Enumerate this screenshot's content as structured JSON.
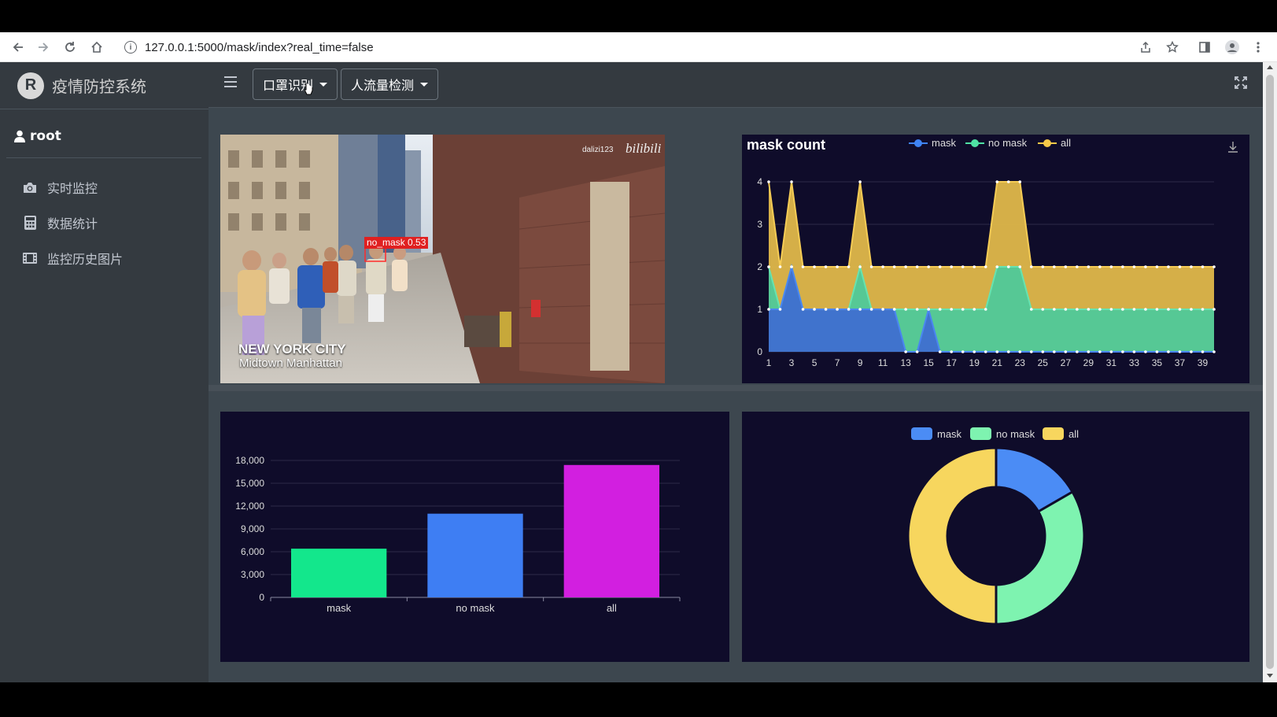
{
  "browser": {
    "url": "127.0.0.1:5000/mask/index?real_time=false",
    "info_glyph": "i"
  },
  "app": {
    "brand_letter": "R",
    "brand_title": "疫情防控系统",
    "user": "root",
    "menu": [
      {
        "label": "实时监控",
        "icon": "camera-icon"
      },
      {
        "label": "数据统计",
        "icon": "calculator-icon"
      },
      {
        "label": "监控历史图片",
        "icon": "film-icon"
      }
    ],
    "header": {
      "dropdowns": [
        "口罩识别",
        "人流量检测"
      ]
    }
  },
  "video": {
    "detection_label": "no_mask 0.53",
    "watermark": "dalizi123",
    "watermark_brand": "bilibili",
    "city_title": "NEW YORK CITY",
    "city_subtitle": "Midtown Manhattan"
  },
  "chart_data": [
    {
      "type": "area",
      "title": "mask count",
      "legend_position": "top",
      "legend": [
        "mask",
        "no mask",
        "all"
      ],
      "colors": {
        "mask": "#5470c6",
        "no mask": "#91cc75",
        "all": "#fac858"
      },
      "colors_display": {
        "mask": "#3f6fd0",
        "no mask": "#4fc99a",
        "all": "#e0b84a"
      },
      "x": [
        1,
        2,
        3,
        4,
        5,
        6,
        7,
        8,
        9,
        10,
        11,
        12,
        13,
        14,
        15,
        16,
        17,
        18,
        19,
        20,
        21,
        22,
        23,
        24,
        25,
        26,
        27,
        28,
        29,
        30,
        31,
        32,
        33,
        34,
        35,
        36,
        37,
        38,
        39,
        40
      ],
      "x_tick_labels": [
        "1",
        "3",
        "5",
        "7",
        "9",
        "11",
        "13",
        "15",
        "17",
        "19",
        "21",
        "23",
        "25",
        "27",
        "29",
        "31",
        "33",
        "35",
        "37",
        "39"
      ],
      "ylim": [
        0,
        4
      ],
      "y_ticks": [
        "0",
        "1",
        "2",
        "3",
        "4"
      ],
      "grid": true,
      "series": [
        {
          "name": "mask",
          "values": [
            1,
            1,
            2,
            1,
            1,
            1,
            1,
            1,
            1,
            1,
            1,
            1,
            0,
            0,
            1,
            0,
            0,
            0,
            0,
            0,
            0,
            0,
            0,
            0,
            0,
            0,
            0,
            0,
            0,
            0,
            0,
            0,
            0,
            0,
            0,
            0,
            0,
            0,
            0,
            0
          ]
        },
        {
          "name": "no mask",
          "values": [
            2,
            1,
            2,
            1,
            1,
            1,
            1,
            1,
            2,
            1,
            1,
            1,
            1,
            1,
            1,
            1,
            1,
            1,
            1,
            1,
            2,
            2,
            2,
            1,
            1,
            1,
            1,
            1,
            1,
            1,
            1,
            1,
            1,
            1,
            1,
            1,
            1,
            1,
            1,
            1
          ]
        },
        {
          "name": "all",
          "values": [
            4,
            2,
            4,
            2,
            2,
            2,
            2,
            2,
            4,
            2,
            2,
            2,
            2,
            2,
            2,
            2,
            2,
            2,
            2,
            2,
            4,
            4,
            4,
            2,
            2,
            2,
            2,
            2,
            2,
            2,
            2,
            2,
            2,
            2,
            2,
            2,
            2,
            2,
            2,
            2
          ]
        }
      ]
    },
    {
      "type": "bar",
      "categories": [
        "mask",
        "no mask",
        "all"
      ],
      "values": [
        6400,
        11000,
        17400
      ],
      "colors": [
        "#13e78c",
        "#3e7ef3",
        "#d21fe0"
      ],
      "ylim": [
        0,
        18000
      ],
      "y_ticks": [
        "0",
        "3,000",
        "6,000",
        "9,000",
        "12,000",
        "15,000",
        "18,000"
      ],
      "grid": true
    },
    {
      "type": "pie",
      "donut": true,
      "legend_position": "top",
      "labels": [
        "mask",
        "no mask",
        "all"
      ],
      "values": [
        1,
        2,
        3
      ],
      "colors": [
        "#4b8cf5",
        "#7ef3b0",
        "#f7d65e"
      ]
    }
  ]
}
